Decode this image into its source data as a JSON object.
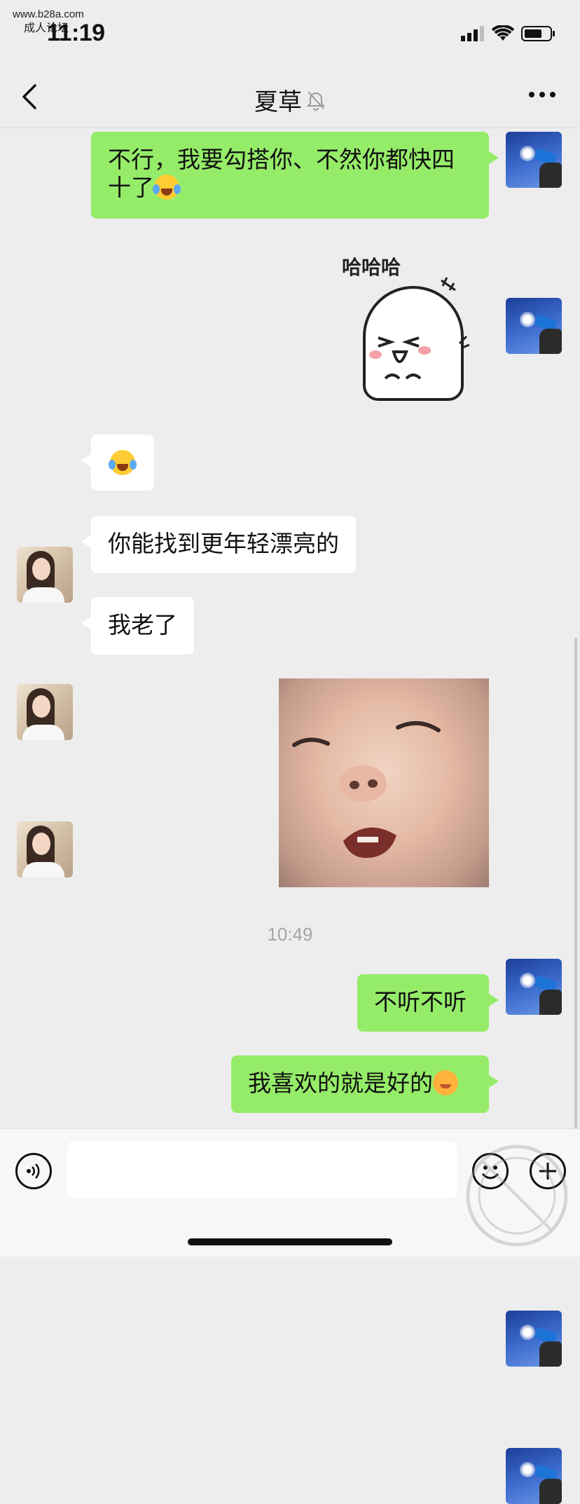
{
  "watermark": {
    "site": "www.b28a.com",
    "forum": "成人论坛"
  },
  "status_bar": {
    "time": "11:19"
  },
  "header": {
    "title": "夏草"
  },
  "messages": [
    {
      "sender": "me",
      "type": "text",
      "text": "不行，我要勾搭你、不然你都快四十了",
      "emoji": "crying-laughing"
    },
    {
      "sender": "me",
      "type": "sticker",
      "sticker_text": "哈哈哈"
    },
    {
      "sender": "other",
      "type": "emoji",
      "emoji": "crying-laughing"
    },
    {
      "sender": "other",
      "type": "text",
      "text": "你能找到更年轻漂亮的"
    },
    {
      "sender": "other",
      "type": "text",
      "text": "我老了"
    },
    {
      "sender": "me",
      "type": "image",
      "image": "baby-face-sticker"
    },
    {
      "type": "timestamp",
      "text": "10:49"
    },
    {
      "sender": "me",
      "type": "text",
      "text": "不听不听"
    },
    {
      "sender": "me",
      "type": "text",
      "text": "我喜欢的就是好的",
      "emoji": "smiling-blush"
    }
  ],
  "input_bar": {
    "placeholder": ""
  },
  "colors": {
    "my_bubble": "#95ec69",
    "other_bubble": "#ffffff",
    "background": "#ededed"
  }
}
